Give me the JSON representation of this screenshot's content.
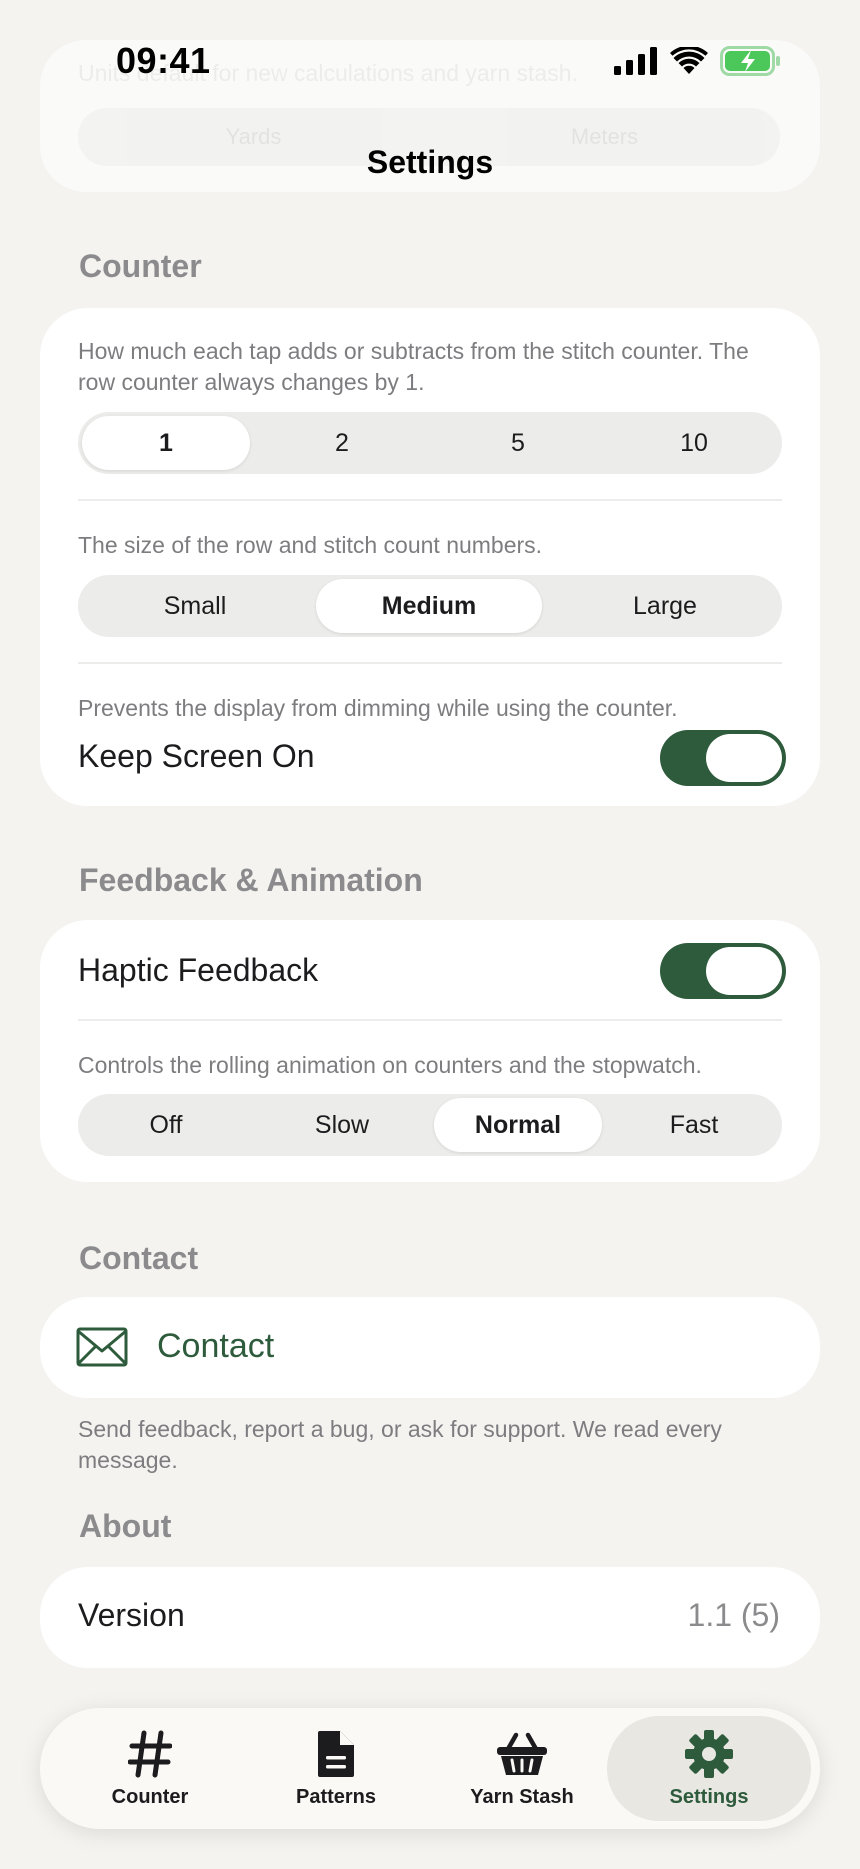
{
  "status_bar": {
    "time": "09:41"
  },
  "nav": {
    "title": "Settings"
  },
  "ghost": {
    "text": "Units default for new calculations and yarn stash.",
    "options": [
      "Yards",
      "Meters"
    ]
  },
  "counter": {
    "header": "Counter",
    "increment_desc": "How much each tap adds or subtracts from the stitch counter. The row counter always changes by 1.",
    "increment_options": [
      "1",
      "2",
      "5",
      "10"
    ],
    "increment_selected": "1",
    "size_desc": "The size of the row and stitch count numbers.",
    "size_options": [
      "Small",
      "Medium",
      "Large"
    ],
    "size_selected": "Medium",
    "screen_desc": "Prevents the display from dimming while using the counter.",
    "screen_label": "Keep Screen On",
    "screen_on": true
  },
  "feedback": {
    "header": "Feedback & Animation",
    "haptic_label": "Haptic Feedback",
    "haptic_on": true,
    "anim_desc": "Controls the rolling animation on counters and the stopwatch.",
    "anim_options": [
      "Off",
      "Slow",
      "Normal",
      "Fast"
    ],
    "anim_selected": "Normal"
  },
  "contact": {
    "header": "Contact",
    "label": "Contact",
    "icon": "envelope-icon",
    "footer": "Send feedback, report a bug, or ask for support. We read every message."
  },
  "about": {
    "header": "About",
    "version_label": "Version",
    "version_value": "1.1 (5)"
  },
  "tabbar": {
    "tabs": [
      {
        "label": "Counter",
        "icon": "hash-icon"
      },
      {
        "label": "Patterns",
        "icon": "document-icon"
      },
      {
        "label": "Yarn Stash",
        "icon": "basket-icon"
      },
      {
        "label": "Settings",
        "icon": "gear-icon"
      }
    ],
    "active": "Settings"
  },
  "colors": {
    "accent": "#2e5b3c",
    "background": "#f4f3f0",
    "card": "#ffffff",
    "secondary_text": "#8b8b8d",
    "battery": "#4cc75a"
  }
}
